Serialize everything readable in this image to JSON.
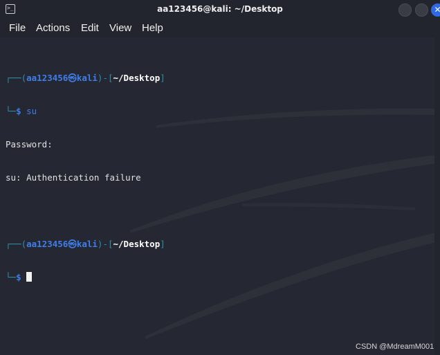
{
  "window": {
    "title": "aa123456@kali: ~/Desktop",
    "close_glyph": "✕",
    "app_icon_glyph": ">_"
  },
  "menu": [
    {
      "label": "File"
    },
    {
      "label": "Actions"
    },
    {
      "label": "Edit"
    },
    {
      "label": "View"
    },
    {
      "label": "Help"
    }
  ],
  "terminal": {
    "prompt1": {
      "frame_open": "┌──(",
      "user": "aa123456㉿kali",
      "frame_mid": ")-[",
      "path": "~/Desktop",
      "frame_close": "]",
      "corner": "└─",
      "dollar": "$",
      "command": "su"
    },
    "output": [
      "Password:",
      "su: Authentication failure"
    ],
    "prompt2": {
      "frame_open": "┌──(",
      "user": "aa123456㉿kali",
      "frame_mid": ")-[",
      "path": "~/Desktop",
      "frame_close": "]",
      "corner": "└─",
      "dollar": "$"
    }
  },
  "watermark": "CSDN @MdreamM001",
  "colors": {
    "background": "#23252e",
    "prompt_user": "#3f7ee8",
    "prompt_frame": "#2f8fa8",
    "close_button": "#2f6ae6"
  }
}
